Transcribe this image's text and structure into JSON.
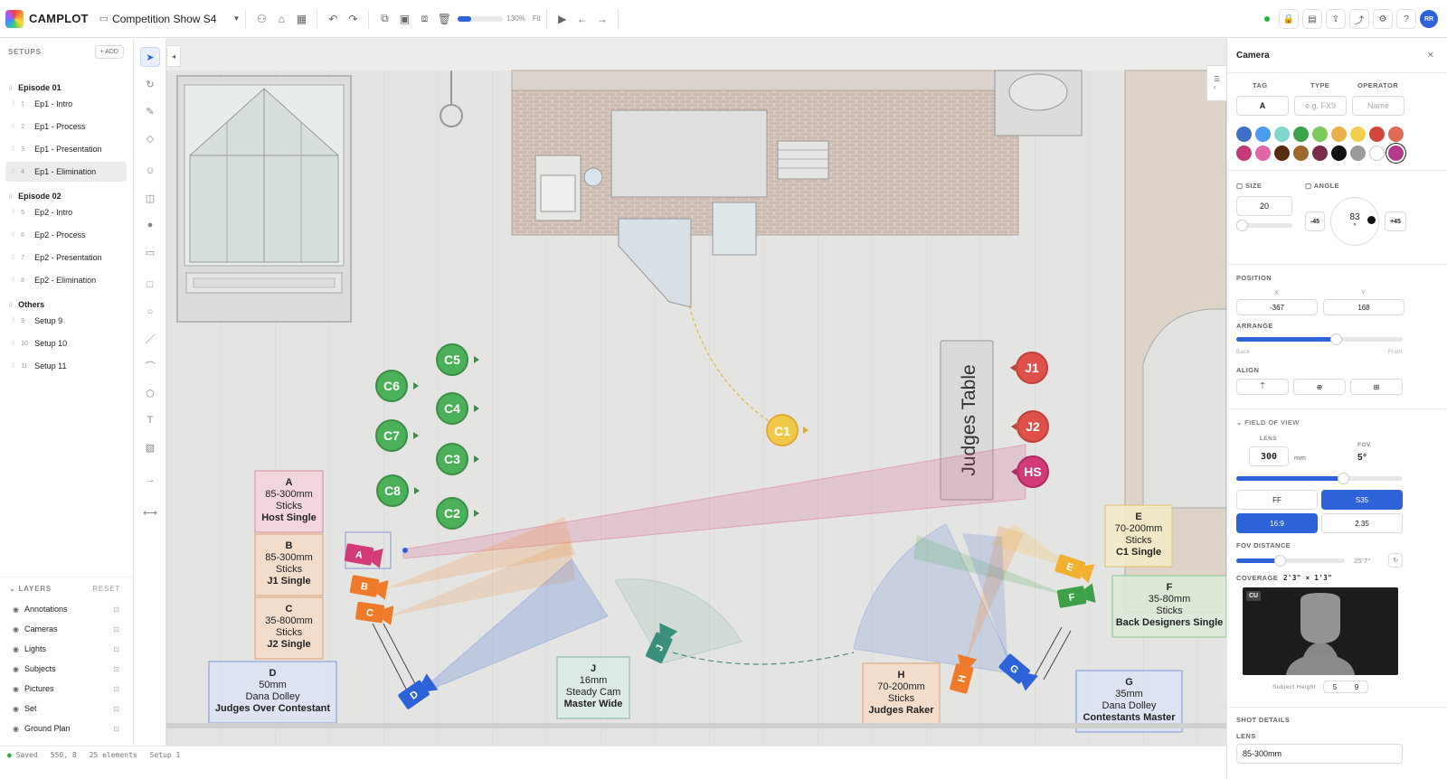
{
  "app": {
    "name": "CAMPLOT",
    "project": "Competition Show S4",
    "zoom": "130%",
    "fit_label": "Fit",
    "zoom_fraction": 0.3,
    "user_initials": "RR"
  },
  "setups": {
    "header": "SETUPS",
    "add_label": "+ ADD",
    "groups": [
      {
        "name": "Episode 01",
        "items": [
          {
            "num": "1",
            "label": "Ep1 - Intro"
          },
          {
            "num": "2",
            "label": "Ep1 - Process"
          },
          {
            "num": "3",
            "label": "Ep1 - Presentation"
          },
          {
            "num": "4",
            "label": "Ep1 - Elimination",
            "active": true
          }
        ]
      },
      {
        "name": "Episode 02",
        "items": [
          {
            "num": "5",
            "label": "Ep2 - Intro"
          },
          {
            "num": "6",
            "label": "Ep2 - Process"
          },
          {
            "num": "7",
            "label": "Ep2 - Presentation"
          },
          {
            "num": "8",
            "label": "Ep2 - Elimination"
          }
        ]
      },
      {
        "name": "Others",
        "items": [
          {
            "num": "9",
            "label": "Setup 9"
          },
          {
            "num": "10",
            "label": "Setup 10"
          },
          {
            "num": "11",
            "label": "Setup 11"
          }
        ]
      }
    ]
  },
  "layers": {
    "header": "LAYERS",
    "reset_label": "RESET",
    "items": [
      "Annotations",
      "Cameras",
      "Lights",
      "Subjects",
      "Pictures",
      "Set",
      "Ground Plan"
    ]
  },
  "canvas": {
    "judges_table": "Judges Table",
    "green_markers": [
      "C6",
      "C5",
      "C4",
      "C7",
      "C3",
      "C8",
      "C2"
    ],
    "yellow_marker": "C1",
    "red_markers": [
      "J1",
      "J2",
      "HS"
    ],
    "camera_labels": [
      {
        "id": "A",
        "lines": [
          "A",
          "85-300mm",
          "Sticks",
          "Host Single"
        ]
      },
      {
        "id": "B",
        "lines": [
          "B",
          "85-300mm",
          "Sticks",
          "J1 Single"
        ]
      },
      {
        "id": "C",
        "lines": [
          "C",
          "35-800mm",
          "Sticks",
          "J2 Single"
        ]
      },
      {
        "id": "D",
        "lines": [
          "D",
          "50mm",
          "Dana Dolley",
          "Judges Over Contestant"
        ]
      },
      {
        "id": "J",
        "lines": [
          "J",
          "16mm",
          "Steady Cam",
          "Master Wide"
        ]
      },
      {
        "id": "H",
        "lines": [
          "H",
          "70-200mm",
          "Sticks",
          "Judges Raker"
        ]
      },
      {
        "id": "G",
        "lines": [
          "G",
          "35mm",
          "Dana Dolley",
          "Contestants Master"
        ]
      },
      {
        "id": "E",
        "lines": [
          "E",
          "70-200mm",
          "Sticks",
          "C1 Single"
        ]
      },
      {
        "id": "F",
        "lines": [
          "F",
          "35-80mm",
          "Sticks",
          "Back Designers Single"
        ]
      }
    ]
  },
  "panel": {
    "title": "Camera",
    "tag_label": "TAG",
    "type_label": "TYPE",
    "operator_label": "OPERATOR",
    "tag_value": "A",
    "type_placeholder": "e.g. FX9",
    "operator_placeholder": "Name",
    "colors": [
      "#3f6fc4",
      "#4a9cf0",
      "#7fd7cc",
      "#3fa04a",
      "#7cc95e",
      "#e8b24a",
      "#f0d04e",
      "#d2463a",
      "#e06a55",
      "#c43a78",
      "#e066a8",
      "#5a2a10",
      "#9a6a2a",
      "#7a2a4a",
      "#111111",
      "#9a9a9a",
      "#ffffff",
      "#b33a8a"
    ],
    "size_label": "SIZE",
    "size_value": "20",
    "size_fraction": 0.1,
    "angle_label": "ANGLE",
    "angle_value": "83",
    "angle_unit": "°",
    "angle_minus": "-45",
    "angle_plus": "+45",
    "position_label": "POSITION",
    "x_label": "X",
    "y_label": "Y",
    "x_value": "-367",
    "y_value": "168",
    "arrange_label": "ARRANGE",
    "arrange_back": "Back",
    "arrange_front": "Front",
    "arrange_fraction": 0.6,
    "align_label": "ALIGN",
    "fov_header": "FIELD OF VIEW",
    "lens_label": "LENS",
    "lens_value": "300",
    "lens_unit": "mm",
    "fov_label": "FOV",
    "fov_value": "5°",
    "lens_fraction": 0.64,
    "sensor_options": [
      "FF",
      "S35"
    ],
    "sensor_selected": "S35",
    "aspect_options": [
      "16:9",
      "2.35"
    ],
    "aspect_selected": "16:9",
    "fov_distance_label": "FOV DISTANCE",
    "fov_distance_value": "25'7\"",
    "fov_distance_fraction": 0.4,
    "coverage_label": "COVERAGE",
    "coverage_value": "2'3\" × 1'3\"",
    "shot_badge": "CU",
    "subject_height_label": "Subject Height",
    "subject_height_ft": "5",
    "subject_height_in": "9",
    "shot_details_label": "SHOT DETAILS",
    "shot_lens_label": "LENS",
    "shot_lens_value": "85-300mm"
  },
  "statusbar": {
    "saved": "Saved",
    "coords": "550, 8",
    "elements": "25 elements",
    "setup": "Setup 1"
  },
  "accent": "#2d62d8"
}
